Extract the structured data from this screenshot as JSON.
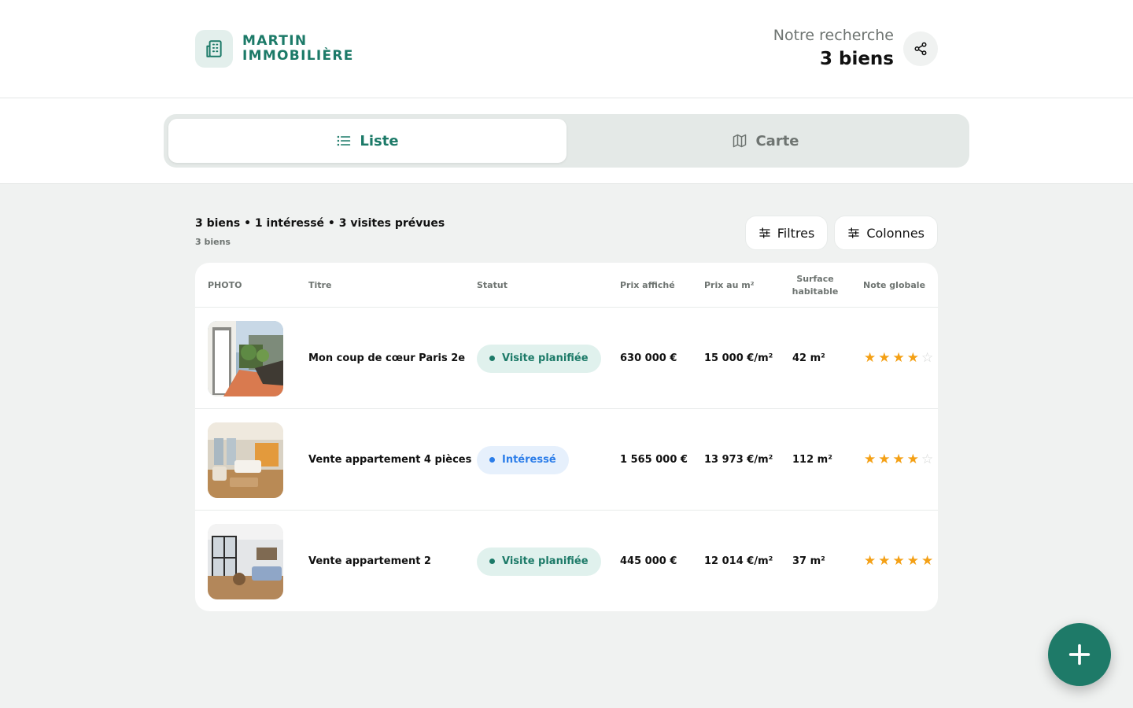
{
  "brand": {
    "line1": "MARTIN",
    "line2": "IMMOBILIÈRE",
    "logo_icon": "building-icon",
    "color": "#1c7a68"
  },
  "search": {
    "label": "Notre recherche",
    "count": "3 biens",
    "share_icon": "share-icon"
  },
  "view_toggle": [
    {
      "label": "Liste",
      "icon": "list-icon",
      "active": true
    },
    {
      "label": "Carte",
      "icon": "map-icon",
      "active": false
    }
  ],
  "summary": {
    "title": "3 biens • 1 intéressé • 3 visites prévues",
    "subtitle": "3 biens"
  },
  "toolbar": {
    "filters_label": "Filtres",
    "columns_label": "Colonnes"
  },
  "table": {
    "columns": {
      "photo": "PHOTO",
      "title": "Titre",
      "status": "Statut",
      "price": "Prix affiché",
      "price_m2": "Prix au m²",
      "surface_line1": "Surface",
      "surface_line2": "habitable",
      "rating": "Note globale"
    },
    "rows": [
      {
        "title": "Mon coup de cœur Paris 2e",
        "status": "Visite planifiée",
        "status_type": "planned",
        "price": "630 000 €",
        "price_m2": "15 000 €/m²",
        "surface": "42 m²",
        "rating": 4,
        "rating_max": 5
      },
      {
        "title": "Vente appartement 4 pièces",
        "status": "Intéressé",
        "status_type": "interested",
        "price": "1 565 000 €",
        "price_m2": "13 973 €/m²",
        "surface": "112 m²",
        "rating": 4,
        "rating_max": 5
      },
      {
        "title": "Vente appartement 2",
        "status": "Visite planifiée",
        "status_type": "planned",
        "price": "445 000 €",
        "price_m2": "12 014 €/m²",
        "surface": "37 m²",
        "rating": 5,
        "rating_max": 5
      }
    ]
  },
  "fab": {
    "icon": "plus-icon"
  },
  "colors": {
    "accent": "#1c7a68",
    "interested": "#2b7de9",
    "star": "#f4a015"
  }
}
